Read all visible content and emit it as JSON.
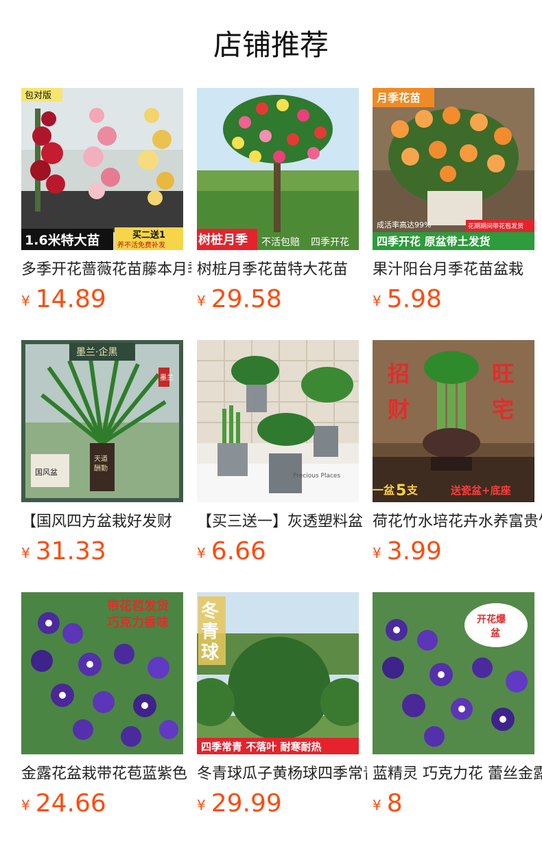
{
  "section_title": "店铺推荐",
  "currency_symbol": "¥",
  "products": [
    {
      "name": "多季开花蔷薇花苗藤本月季",
      "price": "14.89",
      "image_badges": [
        "包对版",
        "1.6米特大苗",
        "买二送1",
        "养不活免费补发"
      ]
    },
    {
      "name": "树桩月季花苗特大花苗",
      "price": "29.58",
      "image_badges": [
        "树桩月季",
        "不活包赔",
        "四季开花"
      ]
    },
    {
      "name": "果汁阳台月季花苗盆栽",
      "price": "5.98",
      "image_badges": [
        "月季花苗",
        "成活率高达99%",
        "花期期间带花苞发货",
        "四季开花 原盆带土发货"
      ]
    },
    {
      "name": "【国风四方盆栽好发财",
      "price": "31.33",
      "image_badges": [
        "墨兰·企黑",
        "墨兰",
        "国风盆"
      ]
    },
    {
      "name": "【买三送一】灰透塑料盆",
      "price": "6.66",
      "image_badges": [
        "Precious Places"
      ]
    },
    {
      "name": "荷花竹水培花卉水养富贵竹",
      "price": "3.99",
      "image_badges": [
        "招",
        "财",
        "旺",
        "宅",
        "一盆",
        "5",
        "支",
        "送瓷盆+底座"
      ]
    },
    {
      "name": "金露花盆栽带花苞蓝紫色",
      "price": "24.66",
      "image_badges": [
        "带花苞发货",
        "巧克力香味"
      ]
    },
    {
      "name": "冬青球瓜子黄杨球四季常青",
      "price": "29.99",
      "image_badges": [
        "冬青球",
        "四季常青 不落叶 耐寒耐热"
      ]
    },
    {
      "name": "蓝精灵 巧克力花 蕾丝金露",
      "price": "8",
      "image_badges": [
        "开花爆盆"
      ]
    }
  ],
  "colors": {
    "price": "#ff4b0d",
    "title": "#111111",
    "product_name": "#222222"
  }
}
